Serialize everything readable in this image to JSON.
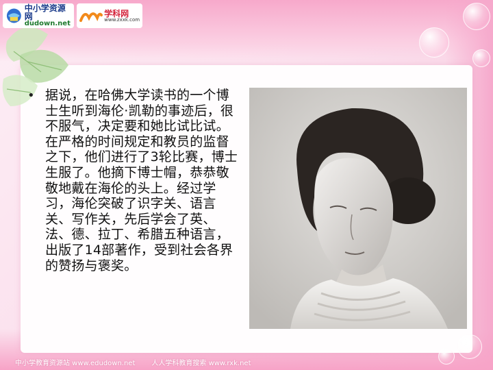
{
  "header": {
    "logo_left_cn": "中小学资源网",
    "logo_left_en": "dudown.net",
    "logo_right_cn": "学科网",
    "logo_right_en": "www.zxxk.com"
  },
  "content": {
    "bullet_text": "据说，在哈佛大学读书的一个博士生听到海伦·凯勒的事迹后，很不服气，决定要和她比试比试。在严格的时间规定和教员的监督之下，他们进行了3轮比赛，博士生服了。他摘下博士帽，恭恭敬敬地戴在海伦的头上。经过学习，海伦突破了识字关、语言关、写作关，先后学会了英、法、德、拉丁、希腊五种语言，出版了14部著作，受到社会各界的赞扬与褒奖。",
    "bullet_symbol": "•"
  },
  "footer": {
    "left_text": "中小学教育资源站 www.edudown.net",
    "right_text": "人人学科教育搜索 www.rxk.net"
  },
  "colors": {
    "accent_pink": "#f6a9cc",
    "text": "#111111"
  },
  "icons": {
    "logo_left": "globe-book-icon",
    "logo_right": "zxxk-wave-icon",
    "decoration": "green-leaf-icon"
  }
}
